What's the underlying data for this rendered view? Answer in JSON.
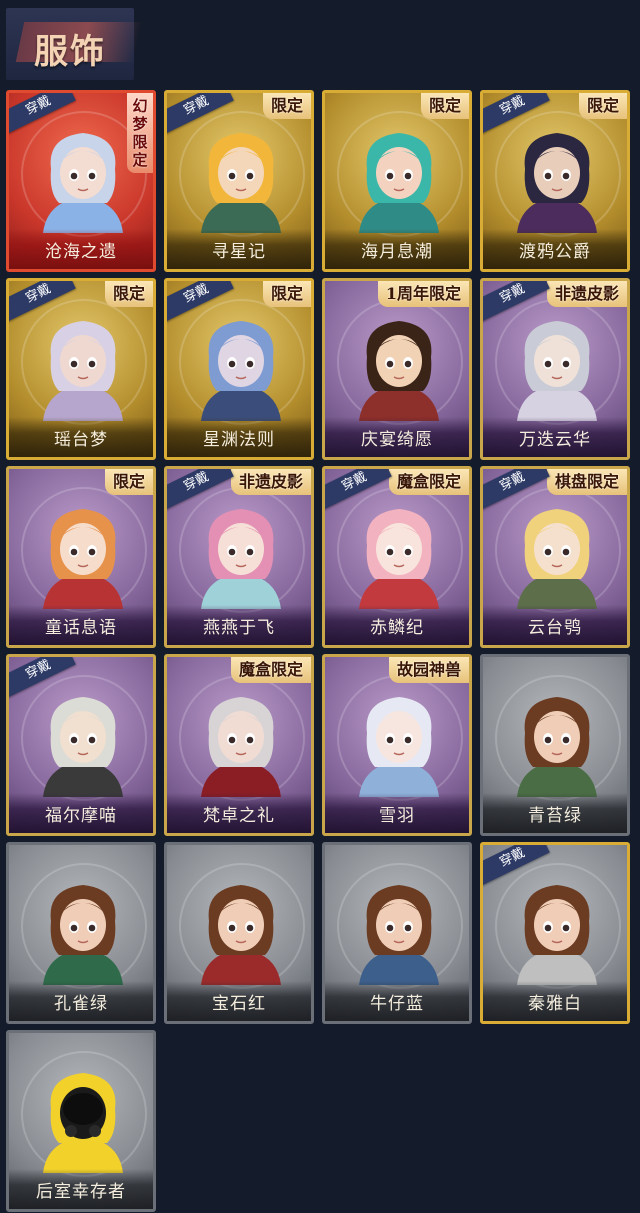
{
  "header": {
    "title": "服饰"
  },
  "worn_label": "穿戴",
  "cards": [
    {
      "name": "沧海之遗",
      "badge": "幻梦限定",
      "worn": true,
      "rarity": "red",
      "hair": "#c7d4ea",
      "skin": "#f3dcd1",
      "cloth": "#8ab2e6"
    },
    {
      "name": "寻星记",
      "badge": "限定",
      "worn": true,
      "rarity": "gold",
      "hair": "#f2b73a",
      "skin": "#f4d6b9",
      "cloth": "#3c6b55"
    },
    {
      "name": "海月息潮",
      "badge": "限定",
      "worn": false,
      "rarity": "gold",
      "hair": "#3ab7a8",
      "skin": "#f3d3c0",
      "cloth": "#2f8b86"
    },
    {
      "name": "渡鸦公爵",
      "badge": "限定",
      "worn": true,
      "rarity": "gold",
      "hair": "#2b2740",
      "skin": "#e9cdbb",
      "cloth": "#4b2c5d"
    },
    {
      "name": "瑶台梦",
      "badge": "限定",
      "worn": true,
      "rarity": "gold",
      "hair": "#d8d0e4",
      "skin": "#efd8d0",
      "cloth": "#b6a6cd"
    },
    {
      "name": "星渊法则",
      "badge": "限定",
      "worn": true,
      "rarity": "gold",
      "hair": "#7e9bd2",
      "skin": "#dfd5e3",
      "cloth": "#3b4d7a"
    },
    {
      "name": "庆宴绮愿",
      "badge": "1周年限定",
      "worn": false,
      "rarity": "purple",
      "hair": "#3a2418",
      "skin": "#f2d2b5",
      "cloth": "#8d2f2a"
    },
    {
      "name": "万迭云华",
      "badge": "非遗皮影",
      "worn": true,
      "rarity": "purple",
      "hair": "#c9ccd6",
      "skin": "#efe1d8",
      "cloth": "#d7d2e2"
    },
    {
      "name": "童话息语",
      "badge": "限定",
      "worn": false,
      "rarity": "purple",
      "hair": "#e7924a",
      "skin": "#f6dccb",
      "cloth": "#b83434"
    },
    {
      "name": "燕燕于飞",
      "badge": "非遗皮影",
      "worn": true,
      "rarity": "purple",
      "hair": "#e48fb4",
      "skin": "#f6dfd6",
      "cloth": "#9fd1d8"
    },
    {
      "name": "赤鳞纪",
      "badge": "魔盒限定",
      "worn": true,
      "rarity": "purple",
      "hair": "#f3b2bf",
      "skin": "#f8e4dc",
      "cloth": "#c33a3e"
    },
    {
      "name": "云台鸮",
      "badge": "棋盘限定",
      "worn": true,
      "rarity": "purple",
      "hair": "#f0d27c",
      "skin": "#f5e0cd",
      "cloth": "#5d6f4a"
    },
    {
      "name": "福尔摩喵",
      "badge": "",
      "worn": true,
      "rarity": "purple",
      "hair": "#dcdcd6",
      "skin": "#f1dfcf",
      "cloth": "#3a3a3a"
    },
    {
      "name": "梵卓之礼",
      "badge": "魔盒限定",
      "worn": false,
      "rarity": "purple",
      "hair": "#d8d4d6",
      "skin": "#f1dcd4",
      "cloth": "#8a1e24"
    },
    {
      "name": "雪羽",
      "badge": "故园神兽",
      "worn": false,
      "rarity": "purple",
      "hair": "#e6e9f3",
      "skin": "#f7e6e0",
      "cloth": "#8fb1d9"
    },
    {
      "name": "青苔绿",
      "badge": "",
      "worn": false,
      "rarity": "grey",
      "hair": "#6b3b22",
      "skin": "#efcdb6",
      "cloth": "#4a6d45"
    },
    {
      "name": "孔雀绿",
      "badge": "",
      "worn": false,
      "rarity": "grey",
      "hair": "#6b3b22",
      "skin": "#efcdb6",
      "cloth": "#2f6b4a"
    },
    {
      "name": "宝石红",
      "badge": "",
      "worn": false,
      "rarity": "grey",
      "hair": "#6b3b22",
      "skin": "#efcdb6",
      "cloth": "#9b2b2b"
    },
    {
      "name": "牛仔蓝",
      "badge": "",
      "worn": false,
      "rarity": "grey",
      "hair": "#6b3b22",
      "skin": "#efcdb6",
      "cloth": "#3d5f8b"
    },
    {
      "name": "秦雅白",
      "badge": "",
      "worn": true,
      "rarity": "grey",
      "hair": "#6b3b22",
      "skin": "#efcdb6",
      "cloth": "#bfbfbf"
    },
    {
      "name": "后室幸存者",
      "badge": "",
      "worn": false,
      "rarity": "grey",
      "hair": "#f2d12a",
      "skin": "#1a1a1a",
      "cloth": "#f2d12a",
      "mask": true
    }
  ]
}
